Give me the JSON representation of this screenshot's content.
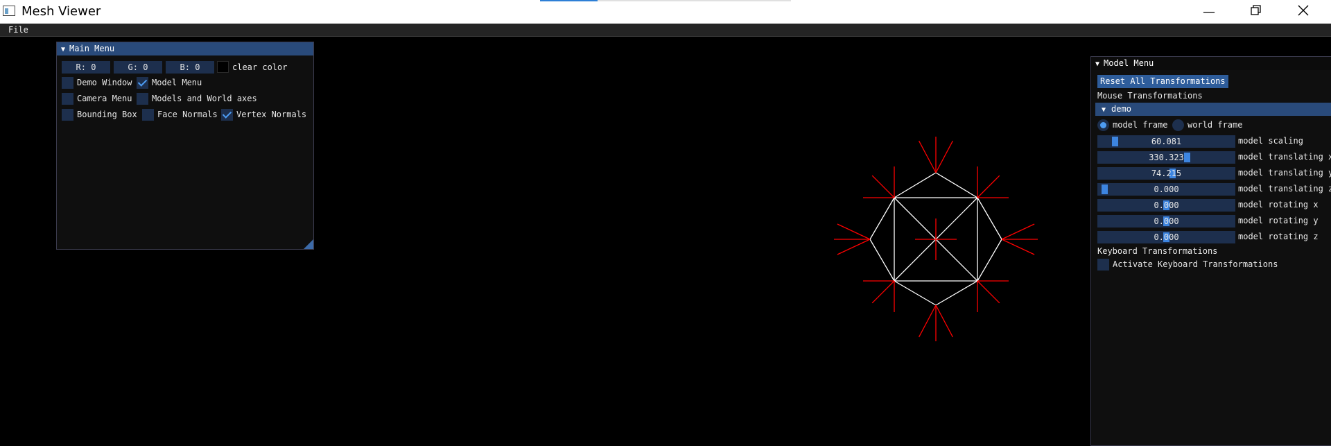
{
  "window": {
    "title": "Mesh Viewer",
    "icon": "app-icon"
  },
  "taskbar_progress": 0.23,
  "menubar": {
    "file": "File"
  },
  "main_menu": {
    "title": "Main Menu",
    "r": "R:  0",
    "g": "G:  0",
    "b": "B:  0",
    "clear_color": "clear color",
    "demo_window": {
      "label": "Demo Window",
      "checked": false
    },
    "model_menu": {
      "label": "Model Menu",
      "checked": true
    },
    "camera_menu": {
      "label": "Camera Menu",
      "checked": false
    },
    "models_world_axes": {
      "label": "Models and World axes",
      "checked": false
    },
    "bounding_box": {
      "label": "Bounding Box",
      "checked": false
    },
    "face_normals": {
      "label": "Face Normals",
      "checked": false
    },
    "vertex_normals": {
      "label": "Vertex Normals",
      "checked": true
    }
  },
  "model_menu": {
    "title": "Model Menu",
    "reset_button": "Reset All Transformations",
    "mouse_transformations": "Mouse Transformations",
    "demo_header": "demo",
    "model_frame": "model frame",
    "world_frame": "world frame",
    "selected_frame": "model frame",
    "sliders": [
      {
        "label": "model scaling",
        "value": "60.081",
        "fill": 0.1
      },
      {
        "label": "model translating x",
        "value": "330.323",
        "fill": 0.66
      },
      {
        "label": "model translating y",
        "value": "74.215",
        "fill": 0.55
      },
      {
        "label": "model translating z",
        "value": "0.000",
        "fill": 0.02
      },
      {
        "label": "model rotating x",
        "value": "0.000",
        "fill": 0.5
      },
      {
        "label": "model rotating y",
        "value": "0.000",
        "fill": 0.5
      },
      {
        "label": "model rotating z",
        "value": "0.000",
        "fill": 0.5
      }
    ],
    "keyboard_transformations": "Keyboard Transformations",
    "activate_keyboard": {
      "label": "Activate Keyboard Transformations",
      "checked": false
    }
  },
  "colors": {
    "accent": "#294a7a",
    "wireframe": "#ffffff",
    "normals": "#ff0000",
    "background": "#000000"
  }
}
